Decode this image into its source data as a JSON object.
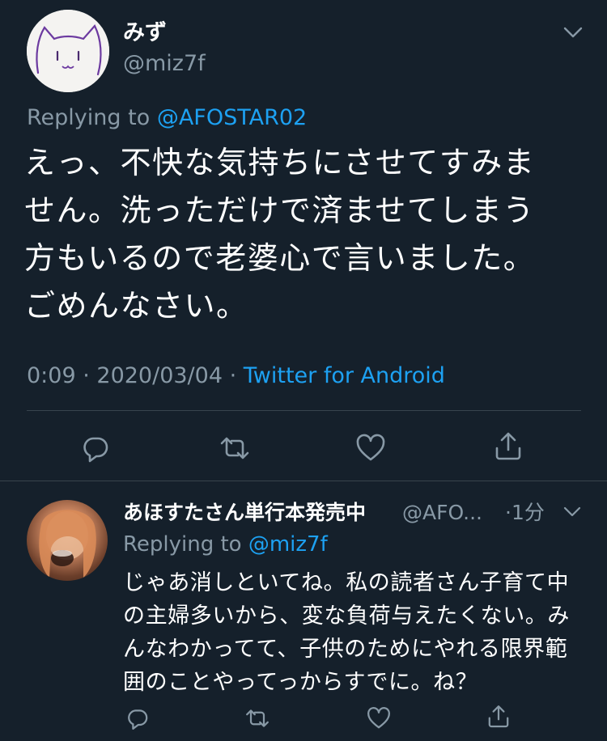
{
  "main_tweet": {
    "display_name": "みず",
    "handle": "@miz7f",
    "replying_prefix": "Replying to ",
    "replying_to": "@AFOSTAR02",
    "text_lines": [
      "えっ、不快な気持ちにさせてすみま",
      "せん。洗っただけで済ませてしまう",
      "方もいるので老婆心で言いました。",
      "ごめんなさい。"
    ],
    "time": "0:09",
    "date": "2020/03/04",
    "separator": " · ",
    "source": "Twitter for Android",
    "avatar_icon": "cat-face-drawing-avatar",
    "actions": [
      "reply-icon",
      "retweet-icon",
      "like-icon",
      "share-icon"
    ]
  },
  "reply_tweet": {
    "display_name": "あほすたさん単行本発売中",
    "handle": "@AFO...",
    "time": "·1分",
    "replying_prefix": "Replying to ",
    "replying_to": "@miz7f",
    "text_lines": [
      "じゃあ消しといてね。私の読者さん子育て中",
      "の主婦多いから、変な負荷与えたくない。み",
      "んなわかってて、子供のためにやれる限界範",
      "囲のことやってっからすでに。ね？"
    ],
    "avatar_icon": "user-photo-avatar",
    "actions": [
      "reply-icon",
      "retweet-icon",
      "like-icon",
      "share-icon"
    ]
  },
  "colors": {
    "background": "#15202b",
    "primary_text": "#ffffff",
    "secondary_text": "#8899a6",
    "link": "#1da1f2",
    "divider": "#38444d"
  }
}
